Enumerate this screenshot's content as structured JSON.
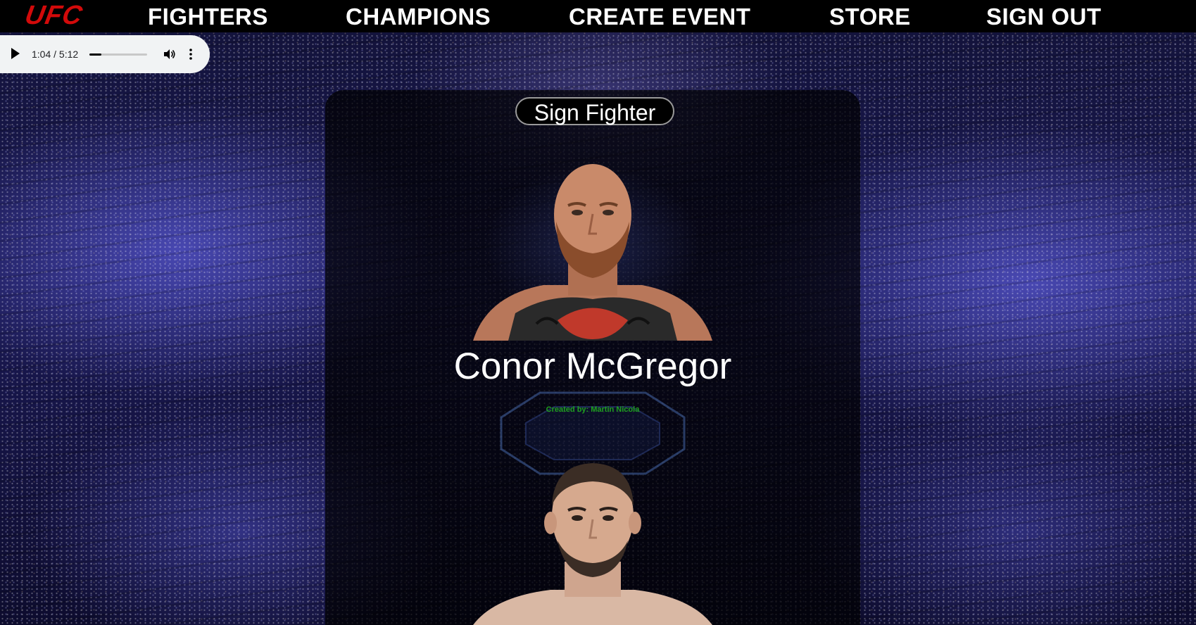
{
  "nav": {
    "logo": "UFC",
    "items": [
      {
        "label": "FIGHTERS"
      },
      {
        "label": "CHAMPIONS"
      },
      {
        "label": "CREATE EVENT"
      },
      {
        "label": "STORE"
      },
      {
        "label": "SIGN OUT"
      }
    ]
  },
  "audio": {
    "time": "1:04 / 5:12",
    "progress_fraction": 0.205,
    "play_icon": "play-icon",
    "volume_icon": "volume-icon",
    "more_icon": "more-vert-icon"
  },
  "panel": {
    "sign_button": "Sign Fighter",
    "fighters": [
      {
        "name": "Conor McGregor"
      },
      {
        "name": ""
      }
    ],
    "credit": "Created by: Martin Nicola"
  },
  "colors": {
    "brand_red": "#d20a0a",
    "nav_bg": "#000000",
    "credit_green": "#1ea01e",
    "arena_blue": "#3b3bb0"
  }
}
